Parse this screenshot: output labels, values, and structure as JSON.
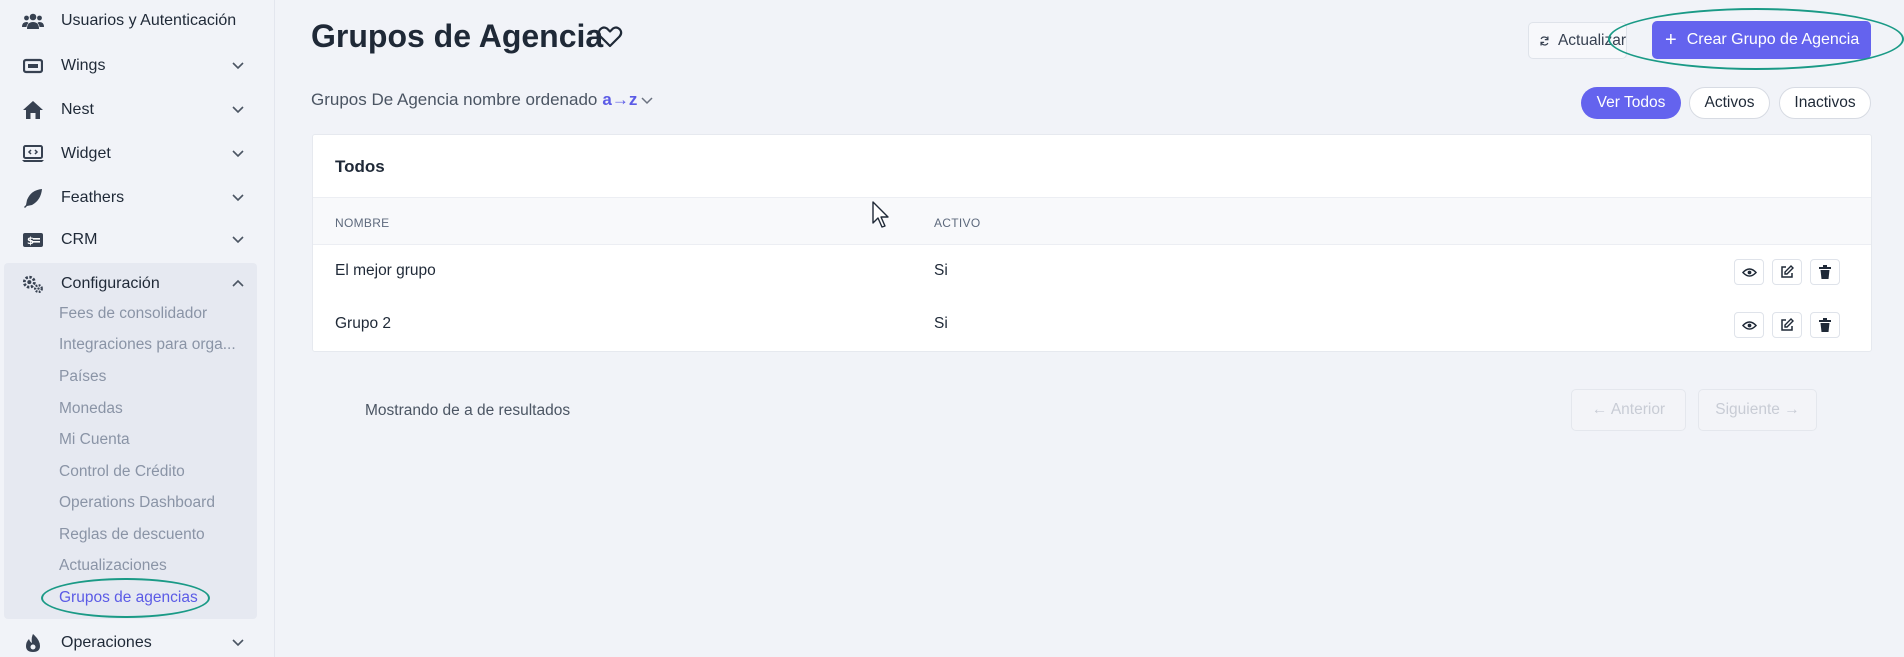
{
  "sidebar": {
    "items": [
      {
        "label": "Usuarios y Autenticación",
        "icon": "users-icon"
      },
      {
        "label": "Wings",
        "icon": "card-icon"
      },
      {
        "label": "Nest",
        "icon": "home-icon"
      },
      {
        "label": "Widget",
        "icon": "widget-icon"
      },
      {
        "label": "Feathers",
        "icon": "feather-icon"
      },
      {
        "label": "CRM",
        "icon": "money-icon"
      },
      {
        "label": "Configuración",
        "icon": "cogs-icon"
      },
      {
        "label": "Operaciones",
        "icon": "fire-icon"
      }
    ],
    "config_items": [
      "Fees de consolidador",
      "Integraciones para orga...",
      "Países",
      "Monedas",
      "Mi Cuenta",
      "Control de Crédito",
      "Operations Dashboard",
      "Reglas de descuento",
      "Actualizaciones",
      "Grupos de agencias"
    ]
  },
  "header": {
    "title": "Grupos de Agencia",
    "refresh_label": "Actualizar",
    "create_label": "Crear Grupo de Agencia"
  },
  "sort": {
    "prefix": "Grupos De Agencia nombre ordenado",
    "key": "a→z"
  },
  "filters": [
    "Ver Todos",
    "Activos",
    "Inactivos"
  ],
  "table": {
    "title": "Todos",
    "columns": [
      "NOMBRE",
      "ACTIVO"
    ],
    "rows": [
      {
        "nombre": "El mejor grupo",
        "activo": "Si"
      },
      {
        "nombre": "Grupo 2",
        "activo": "Si"
      }
    ]
  },
  "pagination": {
    "result_text": "Mostrando de a de resultados",
    "prev_label": "← Anterior",
    "next_label": "Siguiente →"
  },
  "colors": {
    "accent": "#6463ee",
    "highlight_ring": "#1a9a86"
  }
}
